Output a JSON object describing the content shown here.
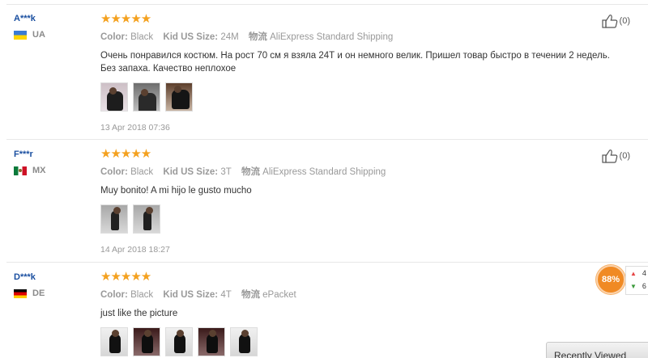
{
  "labels": {
    "color": "Color:",
    "size": "Kid US Size:",
    "shipping": "物流"
  },
  "colors": {
    "star": "#f4a11f",
    "username": "#1a4fa0",
    "badge": "#f08a24"
  },
  "reviews": [
    {
      "user": "A***k",
      "country": "UA",
      "stars": "★★★★★",
      "color": "Black",
      "size": "24M",
      "shipping": "AliExpress Standard Shipping",
      "text": "Очень понравился костюм. На рост 70 см я взяла 24Т и он немного велик. Пришел товар быстро в течении 2 недель. Без запаха. Качество неплохое",
      "photos": [
        "photo-1",
        "photo-2",
        "photo-3"
      ],
      "date": "13 Apr 2018 07:36",
      "likes": "(0)"
    },
    {
      "user": "F***r",
      "country": "MX",
      "stars": "★★★★★",
      "color": "Black",
      "size": "3T",
      "shipping": "AliExpress Standard Shipping",
      "text": "Muy bonito! A mi hijo le gusto mucho",
      "photos": [
        "photo-1",
        "photo-2"
      ],
      "date": "14 Apr 2018 18:27",
      "likes": "(0)"
    },
    {
      "user": "D***k",
      "country": "DE",
      "stars": "★★★★★",
      "color": "Black",
      "size": "4T",
      "shipping": "ePacket",
      "text": "just like the picture",
      "photos": [
        "photo-1",
        "photo-2",
        "photo-3",
        "photo-4",
        "photo-5"
      ],
      "date": "",
      "likes": ""
    }
  ],
  "widget": {
    "percent": "88%",
    "row1": "4",
    "row2": "6",
    "icon_up": "arrow-up-icon",
    "icon_down": "arrow-down-icon"
  },
  "recently_viewed": "Recently Viewed"
}
